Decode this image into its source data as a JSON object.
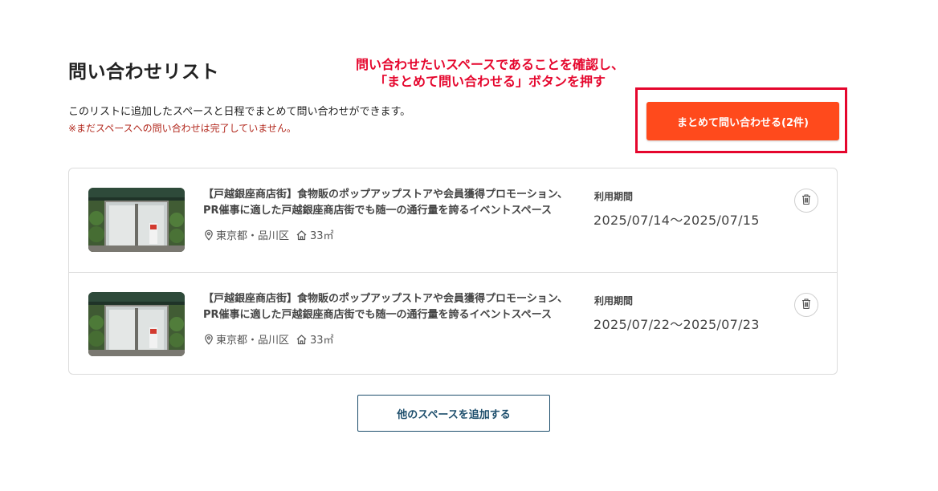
{
  "header": {
    "title": "問い合わせリスト",
    "description": "このリストに追加したスペースと日程でまとめて問い合わせができます。",
    "note": "※まだスペースへの問い合わせは完了していません。"
  },
  "annotation": {
    "line1": "問い合わせたいスペースであることを確認し、",
    "line2": "「まとめて問い合わせる」ボタンを押す",
    "color": "#e5062d"
  },
  "bulk_inquiry_button": {
    "label": "まとめて問い合わせる(2件)",
    "color": "#ff4a1c"
  },
  "items": [
    {
      "title": "【戸越銀座商店街】食物販のポップアップストアや会員獲得プロモーション、PR催事に適した戸越銀座商店街でも随一の通行量を誇るイベントスペース",
      "location": "東京都・品川区",
      "area": "33㎡",
      "period_label": "利用期間",
      "period": "2025/07/14〜2025/07/15",
      "icons": {
        "location": "map-pin-icon",
        "area": "house-icon",
        "delete": "trash-icon"
      }
    },
    {
      "title": "【戸越銀座商店街】食物販のポップアップストアや会員獲得プロモーション、PR催事に適した戸越銀座商店街でも随一の通行量を誇るイベントスペース",
      "location": "東京都・品川区",
      "area": "33㎡",
      "period_label": "利用期間",
      "period": "2025/07/22〜2025/07/23",
      "icons": {
        "location": "map-pin-icon",
        "area": "house-icon",
        "delete": "trash-icon"
      }
    }
  ],
  "add_space_button": {
    "label": "他のスペースを追加する",
    "color": "#1d4e6c"
  }
}
